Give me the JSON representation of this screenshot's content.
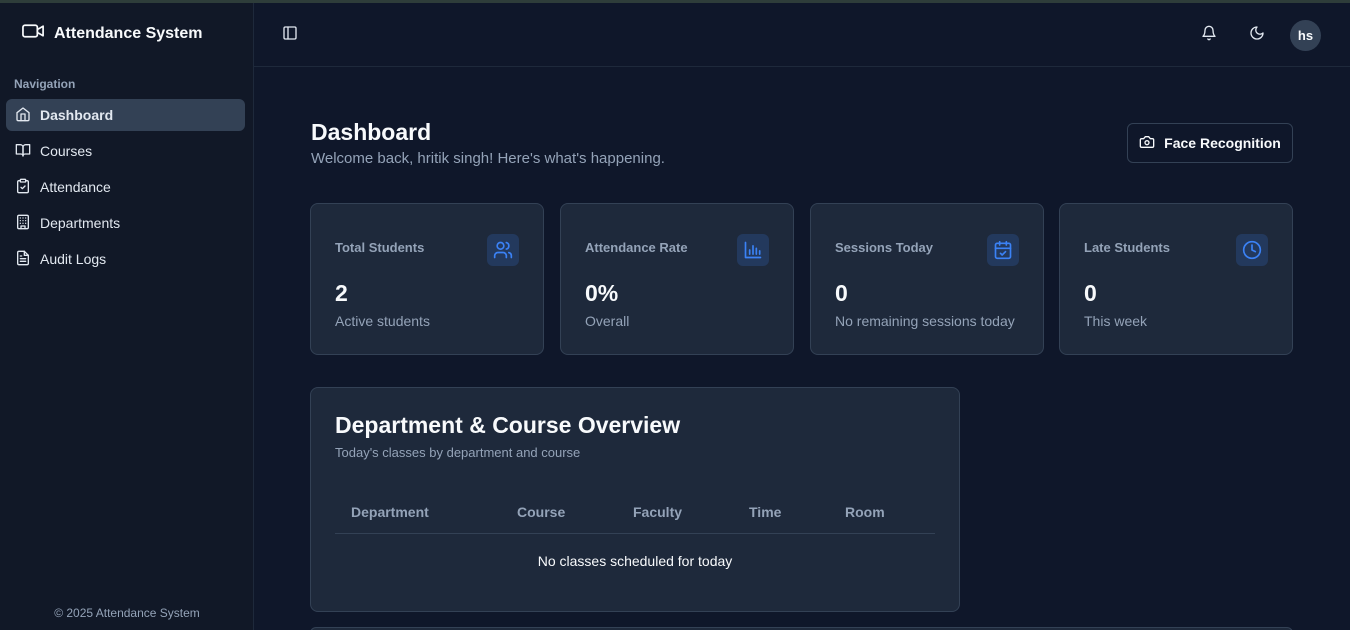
{
  "app": {
    "title": "Attendance System"
  },
  "sidebar": {
    "heading": "Navigation",
    "items": [
      {
        "label": "Dashboard",
        "icon": "home-icon",
        "active": true
      },
      {
        "label": "Courses",
        "icon": "book-open-icon"
      },
      {
        "label": "Attendance",
        "icon": "clipboard-check-icon"
      },
      {
        "label": "Departments",
        "icon": "building-icon"
      },
      {
        "label": "Audit Logs",
        "icon": "file-text-icon"
      }
    ],
    "footer": "© 2025 Attendance System"
  },
  "header": {
    "user_initials": "hs",
    "icons": [
      "sidebar-toggle-icon",
      "bell-icon",
      "moon-icon"
    ]
  },
  "page": {
    "title": "Dashboard",
    "subtitle": "Welcome back, hritik singh! Here's what's happening.",
    "face_button": "Face Recognition"
  },
  "cards": [
    {
      "label": "Total Students",
      "value": "2",
      "sub": "Active students",
      "icon": "users-icon"
    },
    {
      "label": "Attendance Rate",
      "value": "0%",
      "sub": "Overall",
      "icon": "bar-chart-icon"
    },
    {
      "label": "Sessions Today",
      "value": "0",
      "sub": "No remaining sessions today",
      "icon": "calendar-check-icon"
    },
    {
      "label": "Late Students",
      "value": "0",
      "sub": "This week",
      "icon": "clock-icon"
    }
  ],
  "overview": {
    "title": "Department & Course Overview",
    "subtitle": "Today's classes by department and course",
    "columns": [
      "Department",
      "Course",
      "Faculty",
      "Time",
      "Room"
    ],
    "empty": "No classes scheduled for today"
  },
  "colors": {
    "background": "#0f172a",
    "card": "#1e293b",
    "accent": "#3b82f6",
    "muted": "#94a3b8"
  }
}
